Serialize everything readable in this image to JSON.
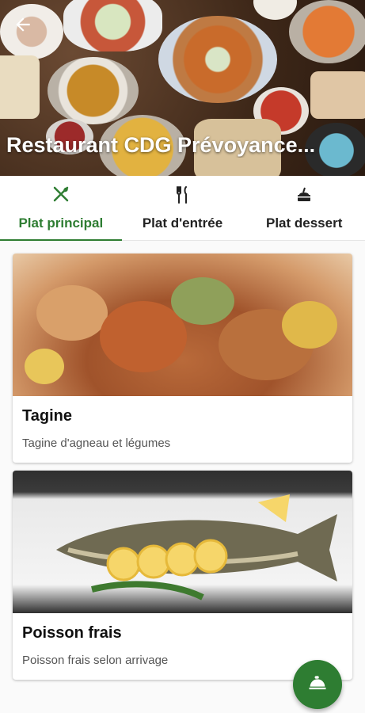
{
  "header": {
    "title": "Restaurant CDG Prévoyance...",
    "back_icon": "arrow-left-icon"
  },
  "tabs": [
    {
      "label": "Plat principal",
      "icon": "fork-spoon-icon",
      "active": true
    },
    {
      "label": "Plat d'entrée",
      "icon": "fork-knife-icon",
      "active": false
    },
    {
      "label": "Plat dessert",
      "icon": "dessert-icon",
      "active": false
    }
  ],
  "dishes": [
    {
      "name": "Tagine",
      "description": "Tagine d'agneau et légumes"
    },
    {
      "name": "Poisson frais",
      "description": "Poisson frais selon arrivage"
    }
  ],
  "fab": {
    "icon": "cloche-icon"
  },
  "colors": {
    "accent": "#2e7d32",
    "text": "#222222"
  }
}
